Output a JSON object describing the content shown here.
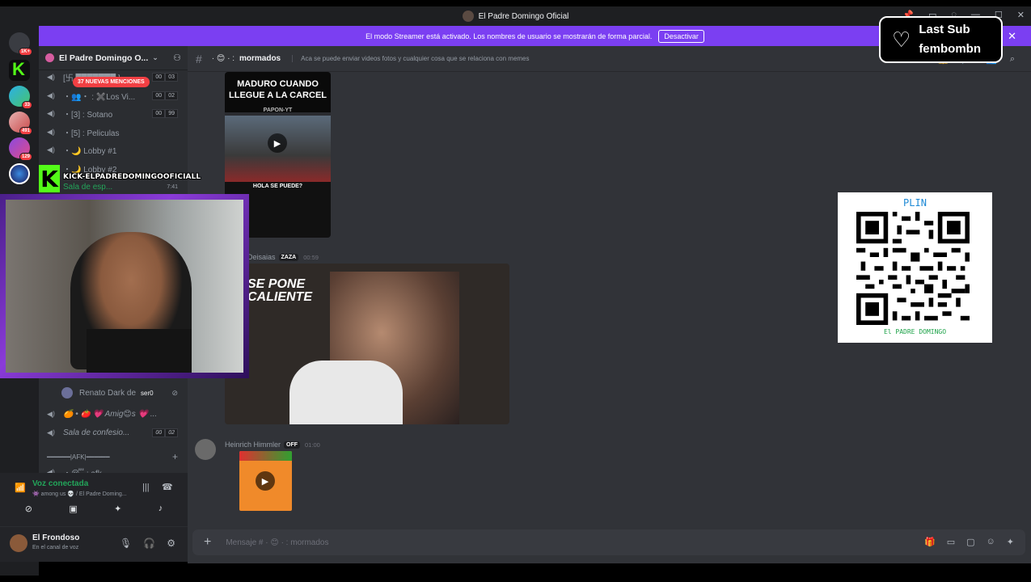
{
  "window": {
    "title": "El Padre Domingo Oficial",
    "controls": [
      "pin",
      "inbox",
      "help",
      "minimize",
      "maximize",
      "close"
    ]
  },
  "banner": {
    "text": "El modo Streamer está activado. Los nombres de usuario se mostrarán de forma parcial.",
    "button": "Desactivar"
  },
  "guild_badges": [
    "1K+",
    "33",
    "491",
    "129"
  ],
  "server": {
    "name": "El Padre Domingo O...",
    "mentions": "37 NUEVAS MENCIONES"
  },
  "channels": [
    {
      "name": "[卐 ███████ ]",
      "c1": "00",
      "c2": "03"
    },
    {
      "name": "・👥・ : ✖️Los Vi...",
      "c1": "00",
      "c2": "02"
    },
    {
      "name": "・[3] : Sotano",
      "c1": "00",
      "c2": "99"
    },
    {
      "name": "・[5] : Peliculas",
      "c1": "",
      "c2": ""
    },
    {
      "name": "・🌙 Lobby #1",
      "c1": "",
      "c2": ""
    },
    {
      "name": "・🌙 Lobby #2",
      "c1": "",
      "c2": ""
    }
  ],
  "waiting_room": {
    "name": "Sala de esp...",
    "time": "7:41"
  },
  "voice_members": [
    {
      "name": "Renato Dark de",
      "tag": "ser0"
    }
  ],
  "channels_lower": [
    {
      "name": "🍊 • 🍅 💗 Amig😊s 💗 ...",
      "c1": "",
      "c2": ""
    },
    {
      "name": "Sala de confesio...",
      "c1": "00",
      "c2": "02"
    },
    {
      "name": "━━━━━━|AFK|━━━━━━",
      "c1": "",
      "c2": ""
    },
    {
      "name": "・😴 : afk",
      "c1": "",
      "c2": ""
    }
  ],
  "voice": {
    "status": "Voz conectada",
    "location": "👾 among us 💀 / El Padre Doming..."
  },
  "user": {
    "name": "El Frondoso",
    "status": "En el canal de voz"
  },
  "channel": {
    "name": "mormados",
    "topic": "Aca se puede enviar videos fotos y cualquier cosa que se relaciona con memes"
  },
  "messages": [
    {
      "overlay_top": "MADURO CUANDO LLEGUE A LA CARCEL",
      "credit": "PAPON-YT",
      "overlay_bottom": "HOLA SE PUEDE?"
    },
    {
      "author": "Deisaias",
      "tag": "ZAZA",
      "time": "00:59",
      "overlay": "SE PONE CALIENTE"
    },
    {
      "author": "Heinrich Himmler",
      "tag": "OFF",
      "time": "01:00"
    }
  ],
  "input": {
    "placeholder": "Mensaje # · 😊 · : mormados"
  },
  "stream_overlay": {
    "kick_handle": "KICK-ELPADREDOMINGOOFICIALL",
    "qr_title": "PLIN",
    "qr_footer": "El PADRE DOMINGO",
    "last_sub_label": "Last Sub",
    "last_sub_name": "fembombn"
  },
  "colors": {
    "accent_banner": "#7b3ff2",
    "kick_green": "#53fc18",
    "mention_red": "#f23f43",
    "plin_blue": "#1e8ad6"
  }
}
